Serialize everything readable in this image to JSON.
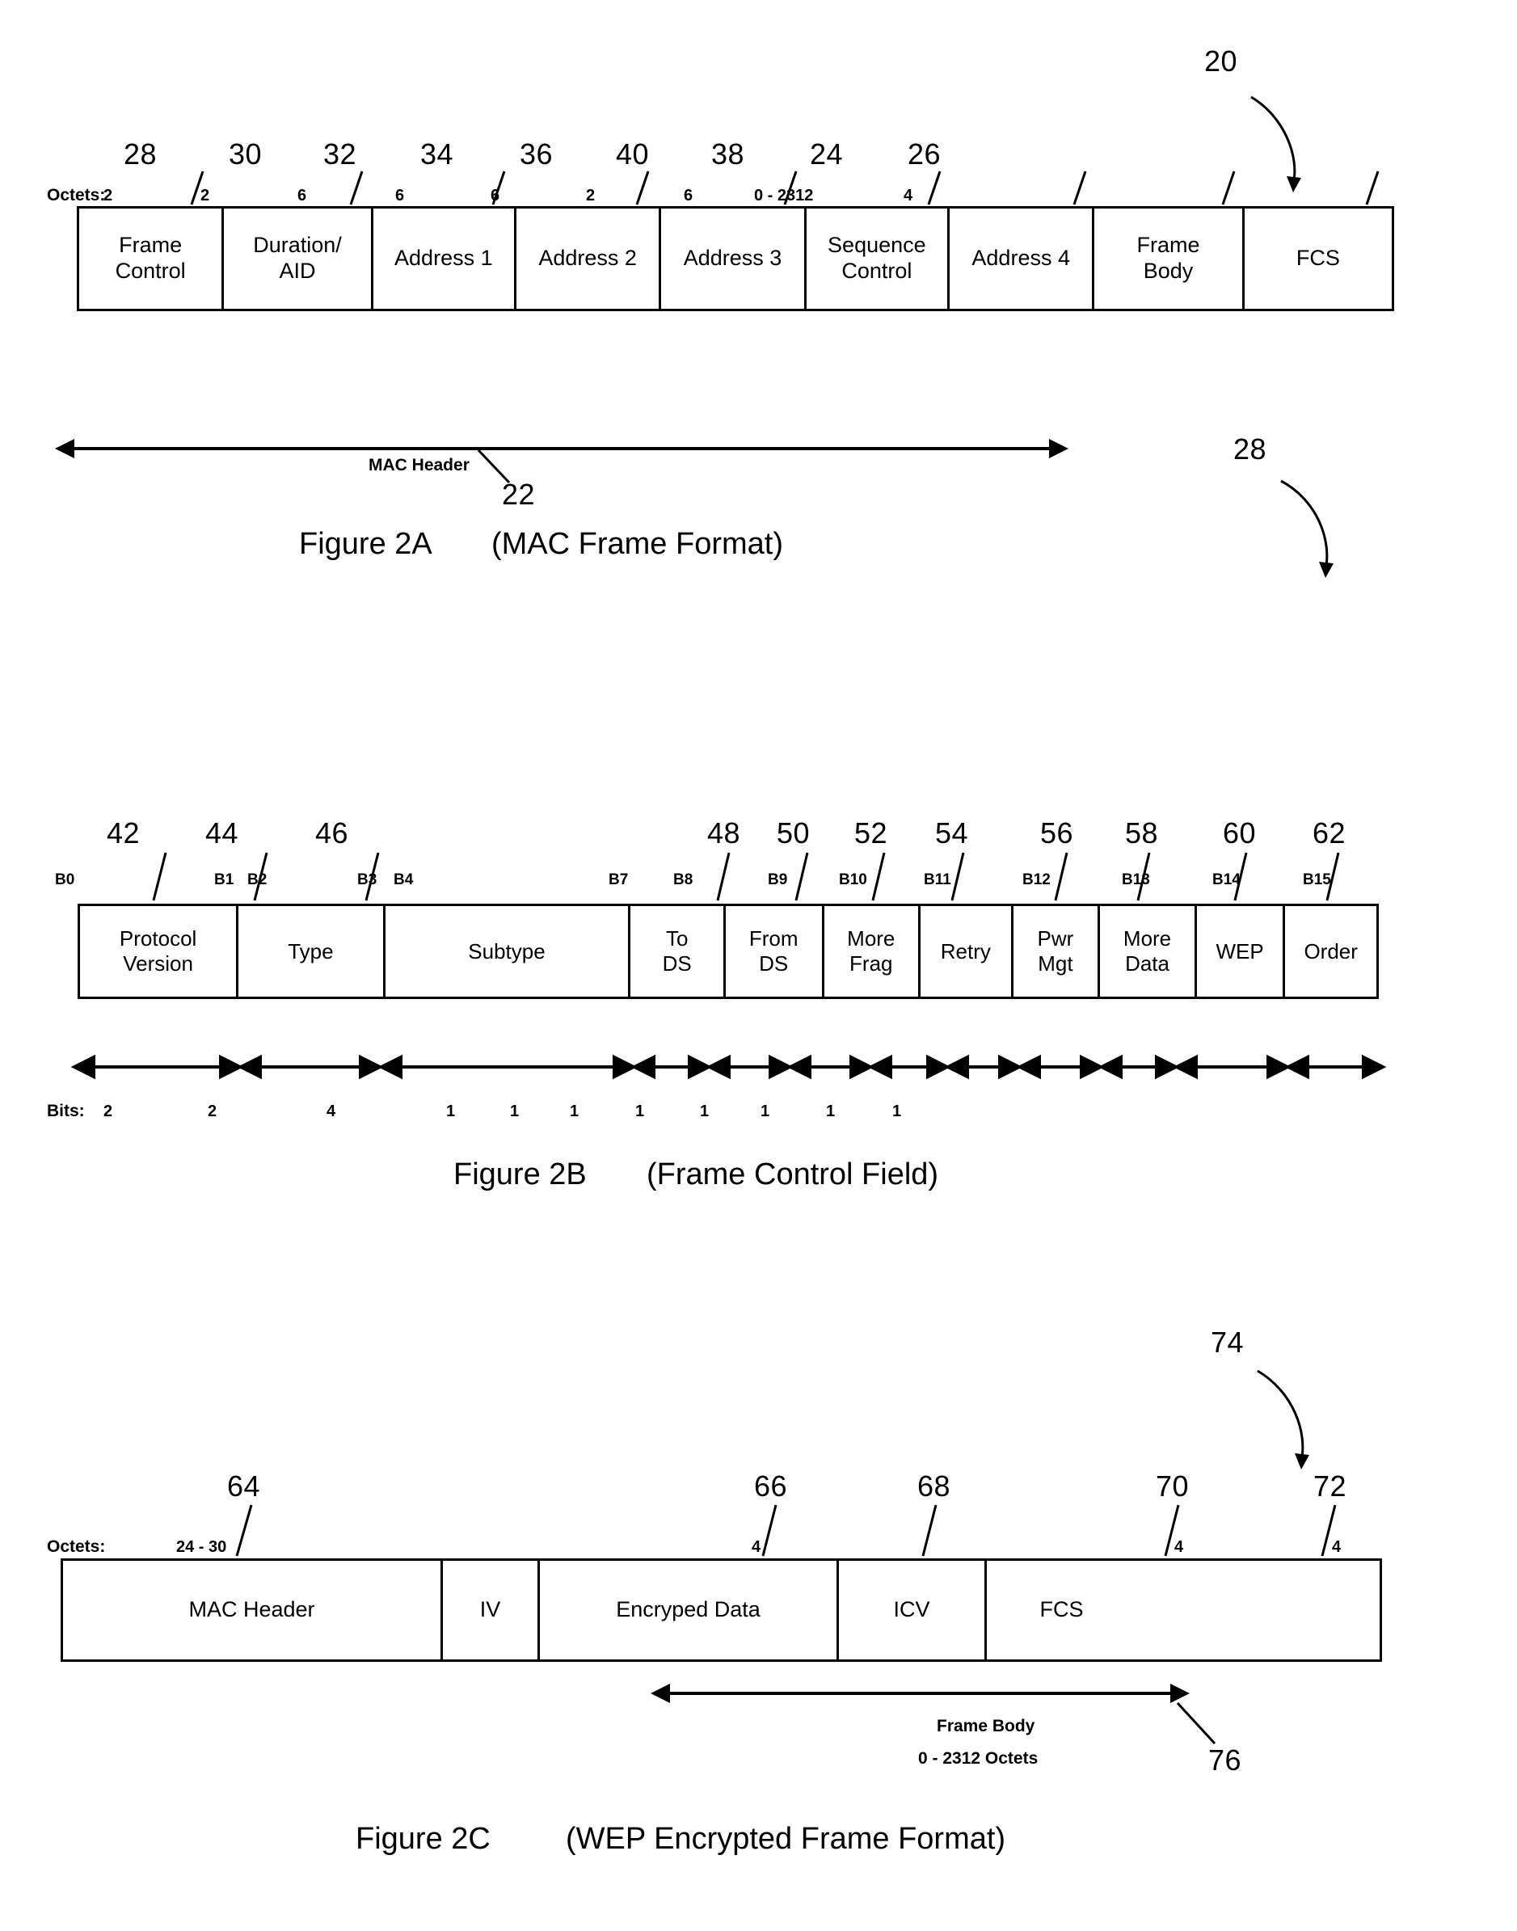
{
  "figures": [
    {
      "id": "2a",
      "caption_label": "Figure 2A",
      "caption_title": "(MAC Frame Format)",
      "unit_label": "Octets:",
      "overall_ref": "20",
      "span_label": "MAC Header",
      "span_ref": "22",
      "fields": [
        {
          "name": "Frame Control",
          "line1": "Frame",
          "line2": "Control",
          "size": "2",
          "ref": "28"
        },
        {
          "name": "Duration/AID",
          "line1": "Duration/",
          "line2": "AID",
          "size": "2",
          "ref": "30"
        },
        {
          "name": "Address 1",
          "line1": "Address 1",
          "line2": "",
          "size": "6",
          "ref": "32"
        },
        {
          "name": "Address 2",
          "line1": "Address 2",
          "line2": "",
          "size": "6",
          "ref": "34"
        },
        {
          "name": "Address 3",
          "line1": "Address 3",
          "line2": "",
          "size": "6",
          "ref": "36"
        },
        {
          "name": "Sequence Control",
          "line1": "Sequence",
          "line2": "Control",
          "size": "2",
          "ref": "40"
        },
        {
          "name": "Address 4",
          "line1": "Address 4",
          "line2": "",
          "size": "6",
          "ref": "38"
        },
        {
          "name": "Frame Body",
          "line1": "Frame",
          "line2": "Body",
          "size": "0 - 2312",
          "ref": "24"
        },
        {
          "name": "FCS",
          "line1": "FCS",
          "line2": "",
          "size": "4",
          "ref": "26"
        }
      ]
    },
    {
      "id": "2b",
      "caption_label": "Figure 2B",
      "caption_title": "(Frame Control Field)",
      "unit_label": "Bits:",
      "overall_ref": "28",
      "fields": [
        {
          "name": "Protocol Version",
          "line1": "Protocol",
          "line2": "Version",
          "bits": "2",
          "ref": "42",
          "bit_start": "B0",
          "bit_end": "B1"
        },
        {
          "name": "Type",
          "line1": "Type",
          "line2": "",
          "bits": "2",
          "ref": "44",
          "bit_start": "B2",
          "bit_end": "B3"
        },
        {
          "name": "Subtype",
          "line1": "Subtype",
          "line2": "",
          "bits": "4",
          "ref": "46",
          "bit_start": "B4",
          "bit_end": "B7"
        },
        {
          "name": "To DS",
          "line1": "To",
          "line2": "DS",
          "bits": "1",
          "ref": "48",
          "bit_start": "B8",
          "bit_end": ""
        },
        {
          "name": "From DS",
          "line1": "From",
          "line2": "DS",
          "bits": "1",
          "ref": "50",
          "bit_start": "B9",
          "bit_end": ""
        },
        {
          "name": "More Frag",
          "line1": "More",
          "line2": "Frag",
          "bits": "1",
          "ref": "52",
          "bit_start": "B10",
          "bit_end": ""
        },
        {
          "name": "Retry",
          "line1": "Retry",
          "line2": "",
          "bits": "1",
          "ref": "54",
          "bit_start": "B11",
          "bit_end": ""
        },
        {
          "name": "Pwr Mgt",
          "line1": "Pwr",
          "line2": "Mgt",
          "bits": "1",
          "ref": "56",
          "bit_start": "B12",
          "bit_end": ""
        },
        {
          "name": "More Data",
          "line1": "More",
          "line2": "Data",
          "bits": "1",
          "ref": "58",
          "bit_start": "B13",
          "bit_end": ""
        },
        {
          "name": "WEP",
          "line1": "WEP",
          "line2": "",
          "bits": "1",
          "ref": "60",
          "bit_start": "B14",
          "bit_end": ""
        },
        {
          "name": "Order",
          "line1": "Order",
          "line2": "",
          "bits": "1",
          "ref": "62",
          "bit_start": "B15",
          "bit_end": ""
        }
      ]
    },
    {
      "id": "2c",
      "caption_label": "Figure 2C",
      "caption_title": "(WEP Encrypted Frame Format)",
      "unit_label": "Octets:",
      "overall_ref": "74",
      "span_label_line1": "Frame Body",
      "span_label_line2": "0 - 2312 Octets",
      "span_ref": "76",
      "fields": [
        {
          "name": "MAC Header",
          "line1": "MAC Header",
          "size": "24 - 30",
          "ref": "64"
        },
        {
          "name": "IV",
          "line1": "IV",
          "size": "4",
          "ref": "66"
        },
        {
          "name": "Encryped Data",
          "line1": "Encryped Data",
          "size": "",
          "ref": "68"
        },
        {
          "name": "ICV",
          "line1": "ICV",
          "size": "4",
          "ref": "70"
        },
        {
          "name": "FCS",
          "line1": "FCS",
          "size": "4",
          "ref": "72"
        }
      ]
    }
  ]
}
